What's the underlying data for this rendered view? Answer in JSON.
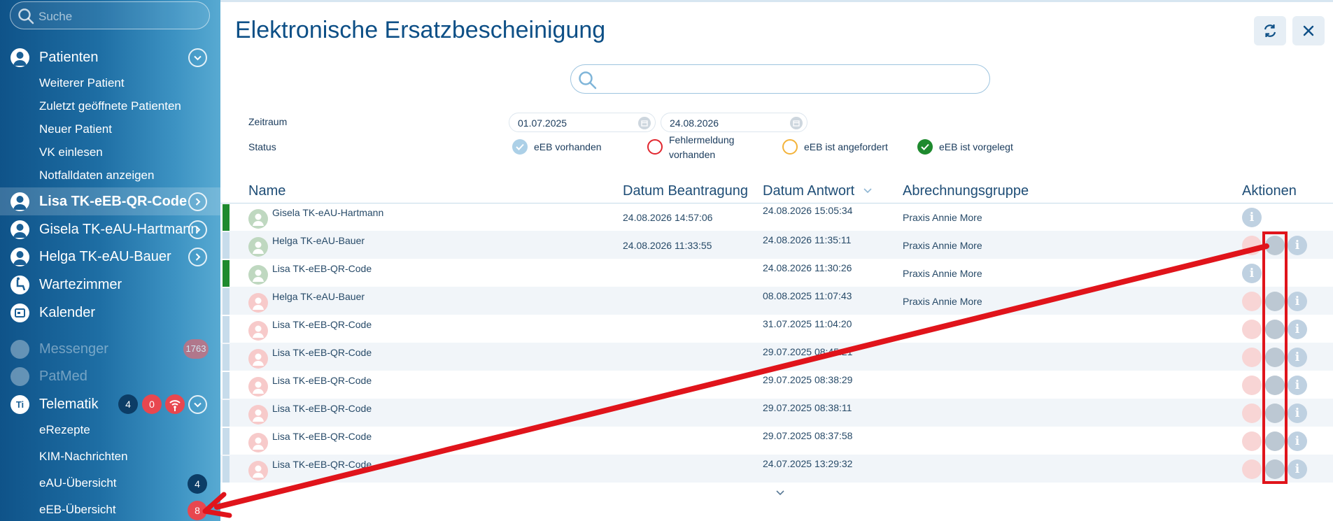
{
  "sidebar": {
    "search_placeholder": "Suche",
    "patienten": "Patienten",
    "sub_items": [
      "Weiterer Patient",
      "Zuletzt geöffnete Patienten",
      "Neuer Patient",
      "VK einlesen",
      "Notfalldaten anzeigen"
    ],
    "patients": [
      "Lisa TK-eEB-QR-Code",
      "Gisela TK-eAU-Hartmann",
      "Helga TK-eAU-Bauer"
    ],
    "wartezimmer": "Wartezimmer",
    "kalender": "Kalender",
    "messenger": "Messenger",
    "messenger_badge": "1763",
    "patmed": "PatMed",
    "telematik": "Telematik",
    "telematik_badge_blue": "4",
    "telematik_badge_red": "0",
    "telematik_sub": [
      "eRezepte",
      "KIM-Nachrichten",
      "eAU-Übersicht",
      "eEB-Übersicht"
    ],
    "eau_badge": "4",
    "eeb_badge": "8"
  },
  "main": {
    "title": "Elektronische Ersatzbescheinigung",
    "zeitraum_label": "Zeitraum",
    "status_label": "Status",
    "date_from": "01.07.2025",
    "date_to": "24.08.2026",
    "legend": [
      "eEB vorhanden",
      "Fehlermeldung",
      "vorhanden",
      "eEB ist angefordert",
      "eEB ist vorgelegt"
    ]
  },
  "table": {
    "headers": [
      "Name",
      "Datum Beantragung",
      "Datum Antwort",
      "Abrechnungsgruppe",
      "Aktionen"
    ],
    "rows": [
      {
        "name": "Gisela TK-eAU-Hartmann",
        "beantragung": "24.08.2026 14:57:06",
        "antwort": "24.08.2026 15:05:34",
        "gruppe": "Praxis Annie More"
      },
      {
        "name": "Helga TK-eAU-Bauer",
        "beantragung": "24.08.2026 11:33:55",
        "antwort": "24.08.2026 11:35:11",
        "gruppe": "Praxis Annie More"
      },
      {
        "name": "Lisa TK-eEB-QR-Code",
        "beantragung": "",
        "antwort": "24.08.2026 11:30:26",
        "gruppe": "Praxis Annie More"
      },
      {
        "name": "Helga TK-eAU-Bauer",
        "beantragung": "",
        "antwort": "08.08.2025 11:07:43",
        "gruppe": "Praxis Annie More"
      },
      {
        "name": "Lisa TK-eEB-QR-Code",
        "beantragung": "",
        "antwort": "31.07.2025 11:04:20",
        "gruppe": ""
      },
      {
        "name": "Lisa TK-eEB-QR-Code",
        "beantragung": "",
        "antwort": "29.07.2025 08:45:21",
        "gruppe": ""
      },
      {
        "name": "Lisa TK-eEB-QR-Code",
        "beantragung": "",
        "antwort": "29.07.2025 08:38:29",
        "gruppe": ""
      },
      {
        "name": "Lisa TK-eEB-QR-Code",
        "beantragung": "",
        "antwort": "29.07.2025 08:38:11",
        "gruppe": ""
      },
      {
        "name": "Lisa TK-eEB-QR-Code",
        "beantragung": "",
        "antwort": "29.07.2025 08:37:58",
        "gruppe": ""
      },
      {
        "name": "Lisa TK-eEB-QR-Code",
        "beantragung": "",
        "antwort": "24.07.2025 13:29:32",
        "gruppe": ""
      }
    ],
    "info_glyph": "i"
  },
  "colors": {
    "accent": "#0d4f86",
    "annotation_red": "#e0141b",
    "status_green": "#1e8a2e"
  }
}
